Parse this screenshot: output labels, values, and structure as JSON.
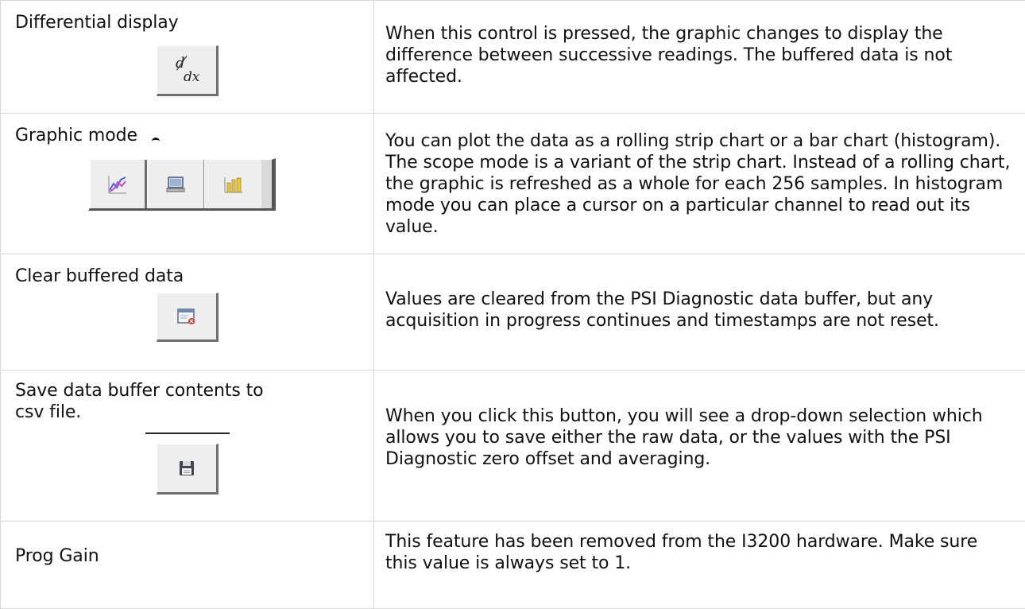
{
  "rows": [
    {
      "control": "Differential display",
      "icon": "derivative-d-dx-icon",
      "icon_glyph_top": "d",
      "icon_glyph_bottom": "dx",
      "description": "When this control is pressed, the graphic changes to display the difference between successive readings.  The buffered data is not affected."
    },
    {
      "control": "Graphic mode",
      "icons": [
        "strip-chart-icon",
        "scope-monitor-icon",
        "histogram-bar-icon"
      ],
      "description": "You can plot the data as a rolling strip chart or a bar chart (histogram).  The scope mode is a variant of the strip chart.  Instead of a rolling chart, the graphic is refreshed as a whole for each 256 samples.  In histogram mode you can place a cursor on a particular channel to read out its value."
    },
    {
      "control": "Clear buffered data",
      "icon": "clear-buffer-icon",
      "description": "Values are cleared from the PSI Diagnostic data buffer, but any acquisition in progress continues and timestamps are not reset."
    },
    {
      "control": "Save data buffer contents to csv file.",
      "icon": "floppy-disk-save-icon",
      "description": "When you click this button, you will see a drop-down selection which allows you to save either the raw data, or the values with the PSI Diagnostic zero offset and averaging."
    },
    {
      "control": "Prog Gain",
      "description": "This feature has been removed from the I3200 hardware. Make sure this value is always set to 1."
    }
  ]
}
